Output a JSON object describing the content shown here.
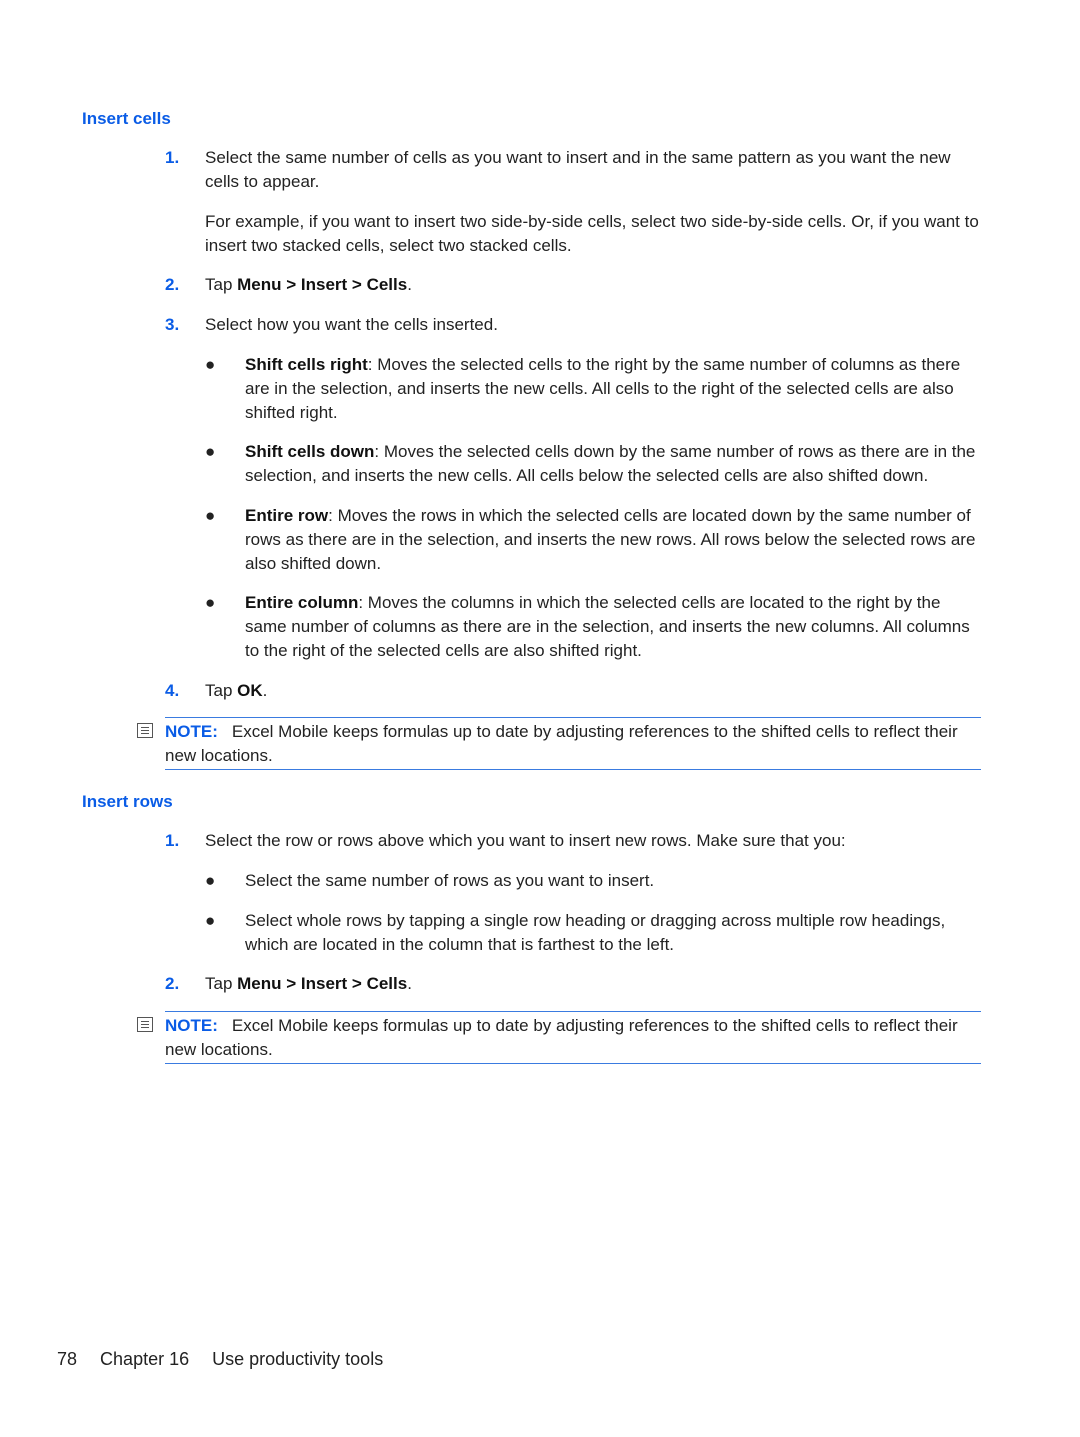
{
  "sections": [
    {
      "heading": "Insert cells",
      "step1": {
        "num": "1.",
        "text": "Select the same number of cells as you want to insert and in the same pattern as you want the new cells to appear."
      },
      "step1_para": "For example, if you want to insert two side-by-side cells, select two side-by-side cells. Or, if you want to insert two stacked cells, select two stacked cells.",
      "step2": {
        "num": "2.",
        "prefix": "Tap ",
        "bold": "Menu > Insert > Cells",
        "suffix": "."
      },
      "step3": {
        "num": "3.",
        "text": "Select how you want the cells inserted."
      },
      "bullets": [
        {
          "bold": "Shift cells right",
          "text": ": Moves the selected cells to the right by the same number of columns as there are in the selection, and inserts the new cells. All cells to the right of the selected cells are also shifted right."
        },
        {
          "bold": "Shift cells down",
          "text": ": Moves the selected cells down by the same number of rows as there are in the selection, and inserts the new cells. All cells below the selected cells are also shifted down."
        },
        {
          "bold": "Entire row",
          "text": ": Moves the rows in which the selected cells are located down by the same number of rows as there are in the selection, and inserts the new rows. All rows below the selected rows are also shifted down."
        },
        {
          "bold": "Entire column",
          "text": ": Moves the columns in which the selected cells are located to the right by the same number of columns as there are in the selection, and inserts the new columns. All columns to the right of the selected cells are also shifted right."
        }
      ],
      "step4": {
        "num": "4.",
        "prefix": "Tap ",
        "bold": "OK",
        "suffix": "."
      },
      "note": {
        "label": "NOTE:",
        "text": "Excel Mobile keeps formulas up to date by adjusting references to the shifted cells to reflect their new locations."
      }
    },
    {
      "heading": "Insert rows",
      "step1": {
        "num": "1.",
        "text": "Select the row or rows above which you want to insert new rows. Make sure that you:"
      },
      "bullets": [
        {
          "text": "Select the same number of rows as you want to insert."
        },
        {
          "text": "Select whole rows by tapping a single row heading or dragging across multiple row headings, which are located in the column that is farthest to the left."
        }
      ],
      "step2": {
        "num": "2.",
        "prefix": "Tap ",
        "bold": "Menu > Insert > Cells",
        "suffix": "."
      },
      "note": {
        "label": "NOTE:",
        "text": "Excel Mobile keeps formulas up to date by adjusting references to the shifted cells to reflect their new locations."
      }
    }
  ],
  "footer": {
    "page": "78",
    "chapter": "Chapter 16",
    "title": "Use productivity tools"
  }
}
